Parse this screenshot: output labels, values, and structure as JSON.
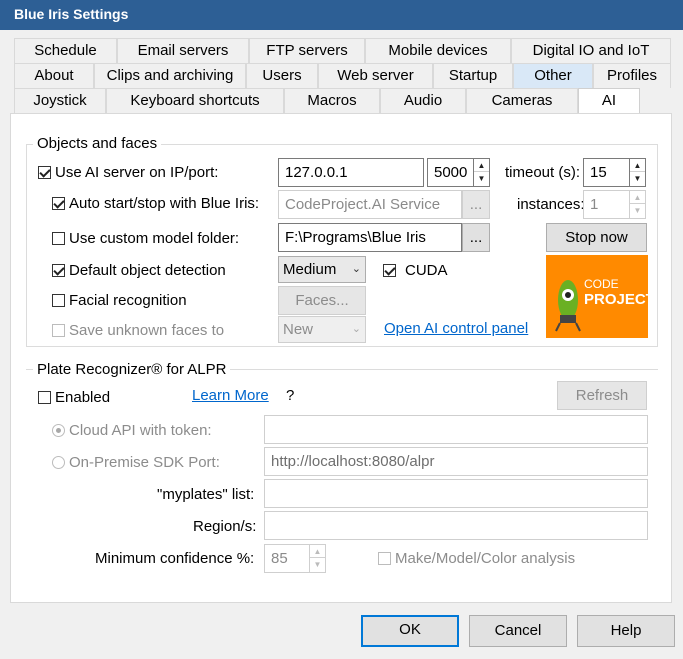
{
  "window": {
    "title": "Blue Iris Settings"
  },
  "tabs": {
    "row1": [
      "Schedule",
      "Email servers",
      "FTP servers",
      "Mobile devices",
      "Digital IO and IoT"
    ],
    "row2": [
      "About",
      "Clips and archiving",
      "Users",
      "Web server",
      "Startup",
      "Other",
      "Profiles"
    ],
    "row3": [
      "Joystick",
      "Keyboard shortcuts",
      "Macros",
      "Audio",
      "Cameras",
      "AI"
    ]
  },
  "objects": {
    "title": "Objects and faces",
    "use_ai_label": "Use AI server on IP/port:",
    "ip_value": "127.0.0.1",
    "port_value": "5000",
    "timeout_label": "timeout (s):",
    "timeout_value": "15",
    "autostart_label": "Auto start/stop with Blue Iris:",
    "service_value": "CodeProject.AI Service",
    "ellipsis": "...",
    "instances_label": "instances:",
    "instances_value": "1",
    "custom_model_label": "Use custom model folder:",
    "model_folder_value": "F:\\Programs\\Blue Iris",
    "stop_button": "Stop now",
    "default_detection_label": "Default object detection",
    "detection_level": "Medium",
    "cuda_label": "CUDA",
    "facial_label": "Facial recognition",
    "faces_button": "Faces...",
    "save_unknown_label": "Save unknown faces to",
    "save_unknown_value": "New",
    "open_panel_link": "Open AI control panel",
    "logo_line1": "CODE",
    "logo_line2": "PROJECT"
  },
  "plate": {
    "title": "Plate Recognizer® for ALPR",
    "enabled_label": "Enabled",
    "learn_more": "Learn More",
    "question": "?",
    "refresh_button": "Refresh",
    "cloud_label": "Cloud API with token:",
    "cloud_value": "",
    "onprem_label": "On-Premise SDK Port:",
    "onprem_value": "http://localhost:8080/alpr",
    "myplates_label": "\"myplates\" list:",
    "myplates_value": "",
    "region_label": "Region/s:",
    "region_value": "",
    "minconf_label": "Minimum confidence %:",
    "minconf_value": "85",
    "mmc_label": "Make/Model/Color analysis"
  },
  "footer": {
    "ok": "OK",
    "cancel": "Cancel",
    "help": "Help"
  },
  "colors": {
    "titlebar": "#2d5f95",
    "link": "#0066cc",
    "logo": "#ff8a00",
    "accent": "#0078d7"
  }
}
